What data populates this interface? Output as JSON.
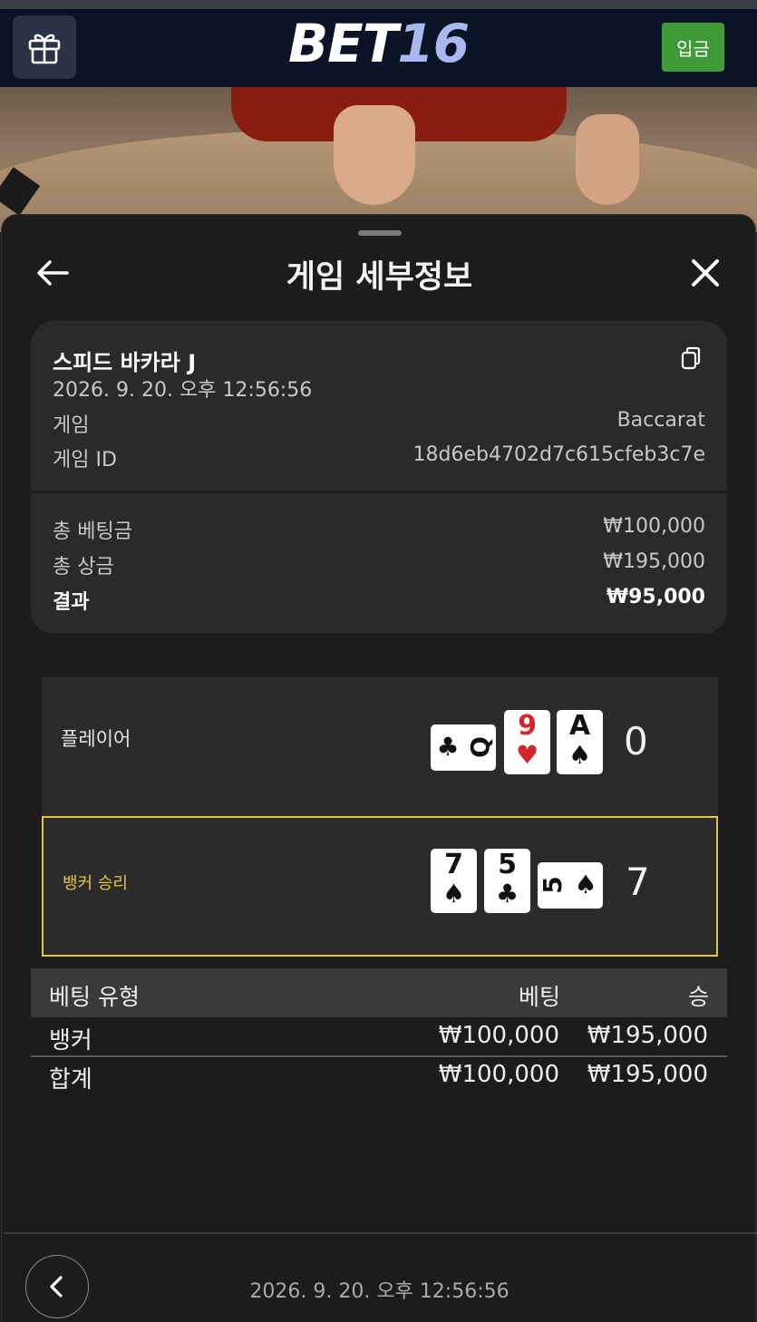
{
  "header": {
    "logo_text": "BET",
    "logo_num": "16",
    "deposit_label": "입금"
  },
  "sheet": {
    "title": "게임 세부정보"
  },
  "details": {
    "game_name": "스피드 바카라 J",
    "datetime": "2026. 9. 20. 오후 12:56:56",
    "game_label": "게임",
    "game_value": "Baccarat",
    "game_id_label": "게임 ID",
    "game_id_value": "18d6eb4702d7c615cfeb3c7e",
    "total_bet_label": "총 베팅금",
    "total_bet_value": "₩100,000",
    "total_win_label": "총 상금",
    "total_win_value": "₩195,000",
    "result_label": "결과",
    "result_value": "₩95,000"
  },
  "player": {
    "label": "플레이어",
    "score": "0",
    "cards": [
      {
        "rank": "Q",
        "suit": "♣",
        "color": "black",
        "orientation": "sideways"
      },
      {
        "rank": "9",
        "suit": "♥",
        "color": "red",
        "orientation": "upright"
      },
      {
        "rank": "A",
        "suit": "♠",
        "color": "black",
        "orientation": "upright"
      }
    ]
  },
  "banker": {
    "label": "뱅커 승리",
    "score": "7",
    "highlight_color": "#e5c33c",
    "cards": [
      {
        "rank": "7",
        "suit": "♠",
        "color": "black",
        "orientation": "upright"
      },
      {
        "rank": "5",
        "suit": "♣",
        "color": "black",
        "orientation": "upright"
      },
      {
        "rank": "5",
        "suit": "♠",
        "color": "black",
        "orientation": "sideways"
      }
    ]
  },
  "bet_table": {
    "headers": [
      "베팅 유형",
      "베팅",
      "승"
    ],
    "rows": [
      [
        "뱅커",
        "₩100,000",
        "₩195,000"
      ],
      [
        "합계",
        "₩100,000",
        "₩195,000"
      ]
    ]
  },
  "footer": {
    "datetime": "2026. 9. 20. 오후 12:56:56"
  },
  "colors": {
    "header_bg": "#0b1427",
    "deposit_bg": "#3f9a37",
    "sheet_bg": "#1c1c1d",
    "card_bg": "#2a2a2b",
    "banker_highlight": "#e5c33c"
  },
  "icons": [
    "gift-icon",
    "back-arrow-icon",
    "close-icon",
    "copy-icon",
    "chevron-left-icon"
  ]
}
